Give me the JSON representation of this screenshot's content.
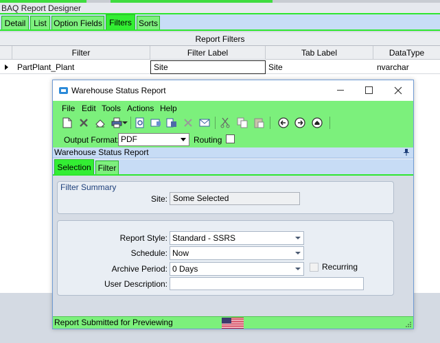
{
  "designer": {
    "title": "BAQ Report Designer",
    "tabs": [
      {
        "label": "Detail"
      },
      {
        "label": "List"
      },
      {
        "label": "Option Fields"
      },
      {
        "label": "Filters"
      },
      {
        "label": "Sorts"
      }
    ],
    "active_tab": "Filters",
    "panel_title": "Report Filters",
    "grid": {
      "columns": [
        "Filter",
        "Filter Label",
        "Tab Label",
        "DataType"
      ],
      "rows": [
        {
          "filter": "PartPlant_Plant",
          "filter_label": "Site",
          "tab_label": "Site",
          "data_type": "nvarchar"
        }
      ]
    }
  },
  "dialog": {
    "title": "Warehouse Status Report",
    "menu": [
      "File",
      "Edit",
      "Tools",
      "Actions",
      "Help"
    ],
    "toolbar_icons": [
      "new-icon",
      "delete-icon",
      "clear-icon",
      "print-icon",
      "print-dropdown-icon",
      "preview-icon",
      "generate-only-icon",
      "print-client-icon",
      "cancel-icon",
      "email-icon",
      "cut-icon",
      "copy-icon",
      "paste-icon",
      "back-icon",
      "forward-icon",
      "home-icon"
    ],
    "output_format": {
      "label": "Output Format:",
      "value": "PDF"
    },
    "routing": {
      "label": "Routing",
      "checked": false
    },
    "subtitle": "Warehouse Status Report",
    "tabs": [
      {
        "label": "Selection"
      },
      {
        "label": "Filter"
      }
    ],
    "active_tab": "Selection",
    "filter_summary": {
      "title": "Filter Summary",
      "site_label": "Site:",
      "site_value": "Some Selected"
    },
    "options": {
      "report_style_label": "Report Style:",
      "report_style_value": "Standard - SSRS",
      "schedule_label": "Schedule:",
      "schedule_value": "Now",
      "archive_label": "Archive Period:",
      "archive_value": "0 Days",
      "recurring_label": "Recurring",
      "recurring_checked": false,
      "user_desc_label": "User Description:",
      "user_desc_value": ""
    },
    "status": "Report Submitted for Previewing"
  },
  "colors": {
    "green_bar": "#7cf07c",
    "active_tab": "#33ee33",
    "accent_line": "#2ee62e",
    "tab_strip": "#c7dcf5"
  }
}
